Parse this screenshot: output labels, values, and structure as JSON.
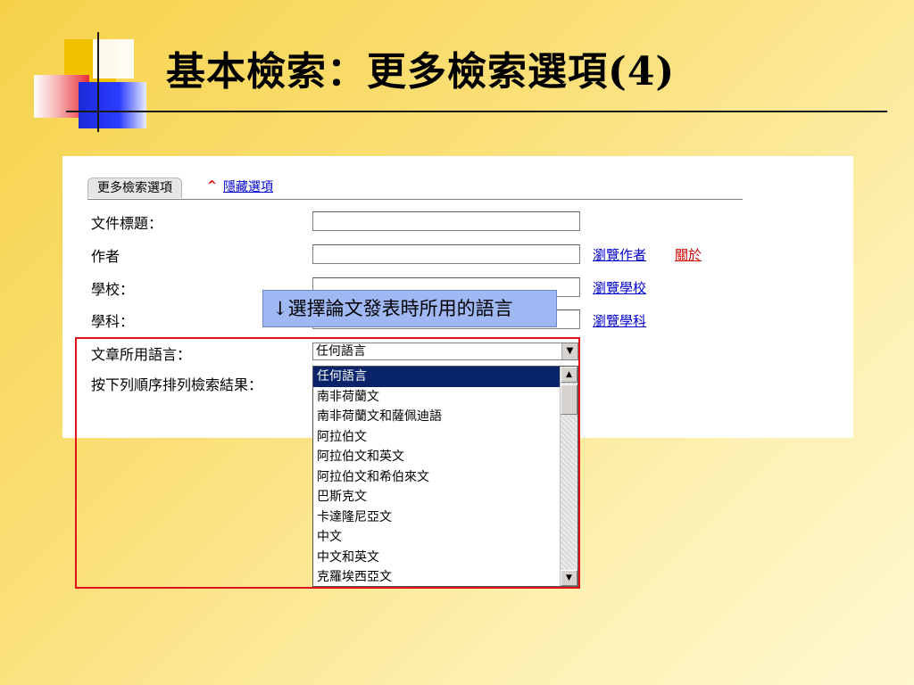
{
  "slide": {
    "title": "基本檢索：更多檢索選項(4)"
  },
  "tabs": {
    "more_options": "更多檢索選項",
    "caret": "^",
    "hide_options": "隱藏選項"
  },
  "form": {
    "document_title_label": "文件標題：",
    "author_label": "作者",
    "school_label": "學校：",
    "subject_label": "學科：",
    "language_label": "文章所用語言：",
    "sort_label": "按下列順序排列檢索結果：",
    "document_title_value": "",
    "author_value": "",
    "school_value": "",
    "subject_value": ""
  },
  "links": {
    "browse_author": "瀏覽作者",
    "about": "關於",
    "browse_school": "瀏覽學校",
    "browse_subject": "瀏覽學科"
  },
  "callout": {
    "text": "↓選擇論文發表時所用的語言"
  },
  "language_select": {
    "selected": "任何語言",
    "options": [
      "任何語言",
      "南非荷蘭文",
      "南非荷蘭文和薩佩迪語",
      "阿拉伯文",
      "阿拉伯文和英文",
      "阿拉伯文和希伯來文",
      "巴斯克文",
      "卡達隆尼亞文",
      "中文",
      "中文和英文",
      "克羅埃西亞文"
    ],
    "highlighted_index": 0
  },
  "colors": {
    "link_blue": "#0000cc",
    "link_red": "#d00000",
    "highlight_red": "#e0101a",
    "callout_blue": "#9fb7f2",
    "selection_navy": "#0a246a"
  },
  "icons": {
    "dropdown": "triangle-down",
    "scroll_up": "triangle-up",
    "scroll_down": "triangle-down"
  }
}
